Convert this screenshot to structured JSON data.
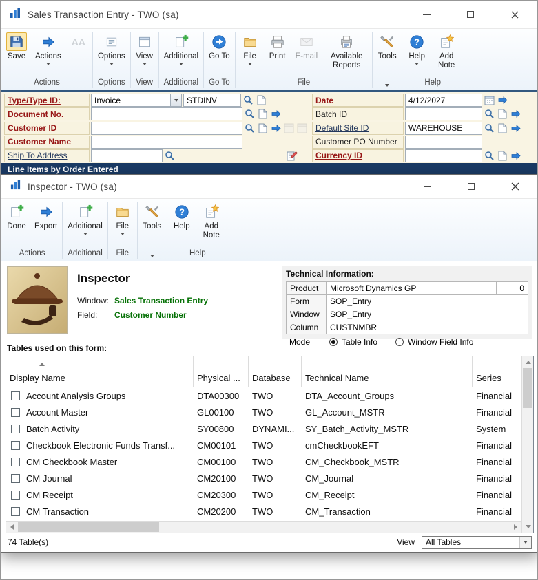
{
  "glyphs": {
    "question": "?"
  },
  "colors": {
    "accent_blue": "#2f7fd6",
    "required_red": "#971616",
    "value_green": "#067106",
    "section_bar_blue": "#1a3a64",
    "highlight_yellow": "#fdeab0"
  },
  "sales": {
    "title": "Sales Transaction Entry  -  TWO (sa)",
    "ribbon": {
      "buttons": {
        "save": "Save",
        "actions": "Actions",
        "aa": "AA",
        "options": "Options",
        "view": "View",
        "additional": "Additional",
        "goto": "Go To",
        "file": "File",
        "print": "Print",
        "email": "E-mail",
        "reports": "Available Reports",
        "tools": "Tools",
        "help": "Help",
        "add_note": "Add Note"
      },
      "groups": {
        "actions": "Actions",
        "options": "Options",
        "view": "View",
        "additional": "Additional",
        "goto": "Go To",
        "file": "File",
        "help": "Help"
      }
    },
    "form": {
      "type_label": "Type/Type ID:",
      "type_value": "Invoice",
      "type_id": "STDINV",
      "document_no_label": "Document No.",
      "customer_id_label": "Customer ID",
      "customer_name_label": "Customer Name",
      "ship_to_label": "Ship To Address",
      "date_label": "Date",
      "date_value": "4/12/2027",
      "batch_label": "Batch ID",
      "site_label": "Default Site ID",
      "site_value": "WAREHOUSE",
      "po_label": "Customer PO Number",
      "currency_label": "Currency ID"
    },
    "section_bar": "Line Items by Order Entered"
  },
  "inspector": {
    "title": "Inspector  -  TWO (sa)",
    "ribbon": {
      "buttons": {
        "done": "Done",
        "export": "Export",
        "additional": "Additional",
        "file": "File",
        "tools": "Tools",
        "help": "Help",
        "add_note": "Add Note"
      },
      "groups": {
        "actions": "Actions",
        "additional": "Additional",
        "file": "File",
        "help": "Help"
      }
    },
    "header": {
      "title": "Inspector",
      "window_label": "Window:",
      "window_value": "Sales Transaction Entry",
      "field_label": "Field:",
      "field_value": "Customer Number"
    },
    "tech": {
      "title": "Technical Information:",
      "product_label": "Product",
      "product_value": "Microsoft Dynamics GP",
      "product_num": "0",
      "form_label": "Form",
      "form_value": "SOP_Entry",
      "window_label": "Window",
      "window_value": "SOP_Entry",
      "column_label": "Column",
      "column_value": "CUSTNMBR",
      "mode_label": "Mode",
      "mode_table": "Table Info",
      "mode_window": "Window Field Info"
    },
    "tables_label": "Tables used on this form:",
    "grid": {
      "columns": [
        "Display Name",
        "Physical ...",
        "Database",
        "Technical Name",
        "Series"
      ],
      "rows": [
        {
          "display": "Account Analysis Groups",
          "physical": "DTA00300",
          "database": "TWO",
          "technical": "DTA_Account_Groups",
          "series": "Financial"
        },
        {
          "display": "Account Master",
          "physical": "GL00100",
          "database": "TWO",
          "technical": "GL_Account_MSTR",
          "series": "Financial"
        },
        {
          "display": "Batch Activity",
          "physical": "SY00800",
          "database": "DYNAMI...",
          "technical": "SY_Batch_Activity_MSTR",
          "series": "System"
        },
        {
          "display": "Checkbook Electronic Funds Transf...",
          "physical": "CM00101",
          "database": "TWO",
          "technical": "cmCheckbookEFT",
          "series": "Financial"
        },
        {
          "display": "CM Checkbook Master",
          "physical": "CM00100",
          "database": "TWO",
          "technical": "CM_Checkbook_MSTR",
          "series": "Financial"
        },
        {
          "display": "CM Journal",
          "physical": "CM20100",
          "database": "TWO",
          "technical": "CM_Journal",
          "series": "Financial"
        },
        {
          "display": "CM Receipt",
          "physical": "CM20300",
          "database": "TWO",
          "technical": "CM_Receipt",
          "series": "Financial"
        },
        {
          "display": "CM Transaction",
          "physical": "CM20200",
          "database": "TWO",
          "technical": "CM_Transaction",
          "series": "Financial"
        }
      ]
    },
    "status": {
      "count": "74 Table(s)",
      "view_label": "View",
      "view_value": "All Tables"
    }
  }
}
